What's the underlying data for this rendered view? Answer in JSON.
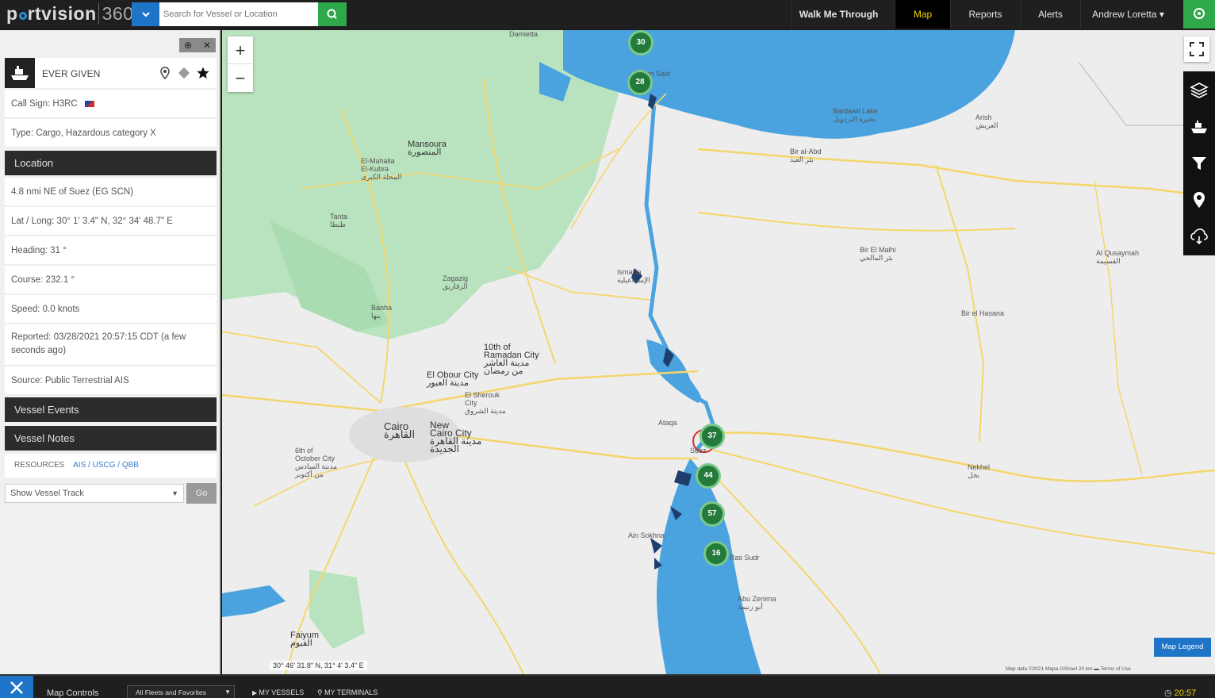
{
  "app": {
    "brand": "p",
    "brand_rest": "rtvision",
    "brand_suffix": "360"
  },
  "search": {
    "placeholder": "Search for Vessel or Location"
  },
  "nav": {
    "walk": "Walk Me Through",
    "map": "Map",
    "reports": "Reports",
    "alerts": "Alerts",
    "user": "Andrew Loretta ▾"
  },
  "vessel": {
    "name": "EVER GIVEN",
    "call_sign": "Call Sign: H3RC",
    "type": "Type: Cargo, Hazardous category X"
  },
  "location": {
    "header": "Location",
    "position": "4.8 nmi NE of Suez (EG SCN)",
    "latlong": "Lat / Long: 30° 1' 3.4\" N, 32° 34' 48.7\" E",
    "heading": "Heading: 31 °",
    "course": "Course: 232.1 °",
    "speed": "Speed: 0.0 knots",
    "reported": "Reported: 03/28/2021 20:57:15 CDT (a few seconds ago)",
    "source": "Source: Public Terrestrial AIS"
  },
  "sections": {
    "events": "Vessel Events",
    "notes": "Vessel Notes"
  },
  "resources": {
    "label": "RESOURCES",
    "ais": "AIS",
    "uscg": "USCG",
    "sep": " / ",
    "qbb": "QBB"
  },
  "track": {
    "select": "Show Vessel Track",
    "go": "Go"
  },
  "map": {
    "clusters": [
      "30",
      "28",
      "37",
      "44",
      "57",
      "16"
    ],
    "labels": {
      "damietta": "Damietta",
      "port_said": "Port Said",
      "mansoura": "Mansoura\nالمنصورة",
      "el_mahalla": "El-Mahalla\nEl-Kubra\nالمحلة الكبرى",
      "tanta": "Tanta\nطنطا",
      "zagazig": "Zagazig\nالزقازيق",
      "benha": "Banha\nبنها",
      "ismailia": "Ismailia\nالإسماعيلية",
      "tenth": "10th of\nRamadan City\nمدينة العاشر\nمن رمضان",
      "obour": "El Obour City\nمدينة العبور",
      "shorouk": "El Sherouk\nCity\nمدينة الشروق",
      "cairo": "Cairo\nالقاهرة",
      "new_cairo": "New\nCairo City\nمدينة القاهرة\nالجديدة",
      "october": "6th of\nOctober City\nمدينة السادس\nمن أكتوبر",
      "suez": "Suez",
      "ain_sokhna": "Ain Sokhna",
      "faiyum": "Faiyum\nالفيوم",
      "el_arish": "Arish\nالعريش",
      "bir_al_abd": "Bir al-Abd\nبئر العبد",
      "bir_el_hasana": "Bir el Hasana",
      "nekhel": "Nekhel\nنخل",
      "bir_el_mahi": "Bir El Malhi\nبئر المالحي",
      "al_qusaymah": "Al Qusaymah\nالقسيمة",
      "bardawil": "Bardawil Lake\nبحيرة البردويل",
      "ras_sudr": "Ras Sudr",
      "abu_zenima": "Abu Zenima\nأبو زنيمة",
      "ataqa": "Ataqa"
    },
    "coords": "30° 46' 31.8\" N, 31° 4' 3.4\" E",
    "legend": "Map Legend",
    "attribution": "Map data ©2021 Mapa GISrael   20 km ▬   Terms of Use",
    "water": "#4aa3df",
    "green": "#a8dbae",
    "road": "#f5d66b"
  },
  "bottom": {
    "controls": "Map Controls",
    "fleets": "All Fleets and Favorites",
    "my_vessels": "MY VESSELS",
    "my_terminals": "MY TERMINALS",
    "time": "20:57 CDT"
  },
  "colors": {
    "accent_blue": "#1e74c7",
    "accent_green": "#2ea84a",
    "active_nav": "#e8d400"
  }
}
